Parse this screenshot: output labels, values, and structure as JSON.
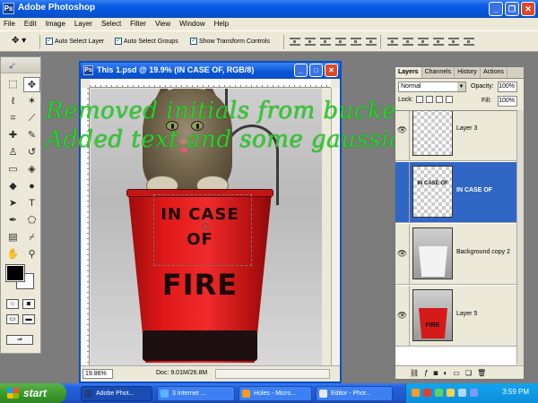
{
  "app": {
    "title": "Adobe Photoshop",
    "icon": "photoshop-icon",
    "accent": "#0654d8"
  },
  "menu": [
    "File",
    "Edit",
    "Image",
    "Layer",
    "Select",
    "Filter",
    "View",
    "Window",
    "Help"
  ],
  "options": {
    "auto_select_layer": "Auto Select Layer",
    "auto_select_groups": "Auto Select Groups",
    "show_transform_controls": "Show Transform Controls",
    "auto_select_layer_checked": true,
    "auto_select_groups_checked": true,
    "show_transform_controls_checked": true
  },
  "document": {
    "title": "This 1.psd @ 19.9% (IN CASE  OF, RGB/8)",
    "zoom": "19.86%",
    "doc_size": "Doc: 9.01M/26.8M",
    "bucket_line1": "IN CASE",
    "bucket_line2": "OF",
    "bucket_line3": "FIRE",
    "overlay_line1": "Removed initials from bucket.",
    "overlay_line2": "Added text and some gaussian blur",
    "overlay_color": "#2bd02b"
  },
  "layers_panel": {
    "tabs": [
      "Layers",
      "Channels",
      "History",
      "Actions"
    ],
    "blend_mode": "Normal",
    "opacity_label": "Opacity:",
    "opacity": "100%",
    "lock_label": "Lock:",
    "fill_label": "Fill:",
    "fill": "100%",
    "layers": [
      {
        "name": "Layer 3",
        "visible": true,
        "selected": false
      },
      {
        "name": "IN CASE  OF",
        "visible": false,
        "selected": true,
        "thumb_text": "IN CASE OF"
      },
      {
        "name": "Background copy 2",
        "visible": true,
        "selected": false
      },
      {
        "name": "Layer 5",
        "visible": true,
        "selected": false,
        "thumb_text": "FIRE"
      }
    ],
    "selected_color": "#3167c4"
  },
  "taskbar": {
    "start": "start",
    "items": [
      {
        "label": "Adobe Phot...",
        "icon": "photoshop-icon",
        "active": true
      },
      {
        "label": "3 Internet ...",
        "icon": "internet-explorer-icon",
        "active": false
      },
      {
        "label": "Holes - Micro...",
        "icon": "windows-media-icon",
        "active": false
      },
      {
        "label": "Editor - Phot...",
        "icon": "browser-icon",
        "active": false
      }
    ],
    "clock": "3:59 PM"
  }
}
